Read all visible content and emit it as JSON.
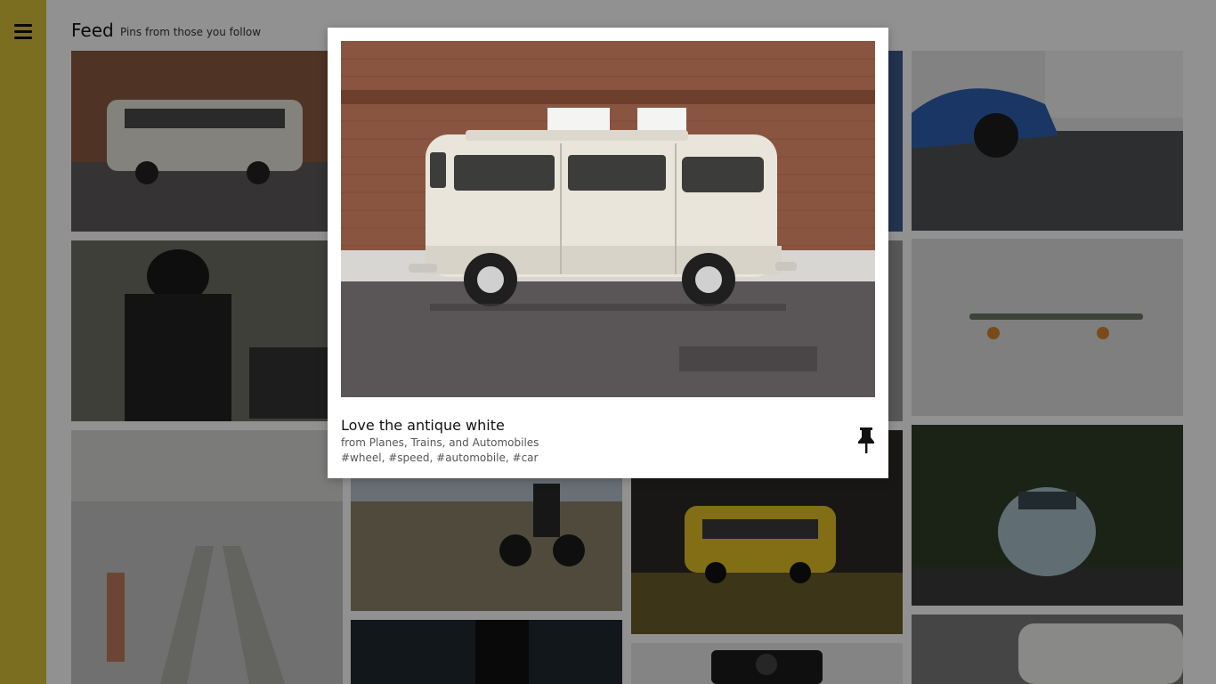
{
  "header": {
    "title": "Feed",
    "subtitle": "Pins from those you follow"
  },
  "sidebar": {
    "menu_icon": "hamburger-menu-icon"
  },
  "modal": {
    "title": "Love the antique white",
    "board": "from Planes, Trains, and Automobiles",
    "tags": "#wheel, #speed, #automobile, #car",
    "pin_icon": "pushpin-icon"
  },
  "colors": {
    "sidebar": "#d8c13a",
    "overlay": "rgba(0,0,0,0.43)",
    "modal_bg": "#ffffff"
  }
}
